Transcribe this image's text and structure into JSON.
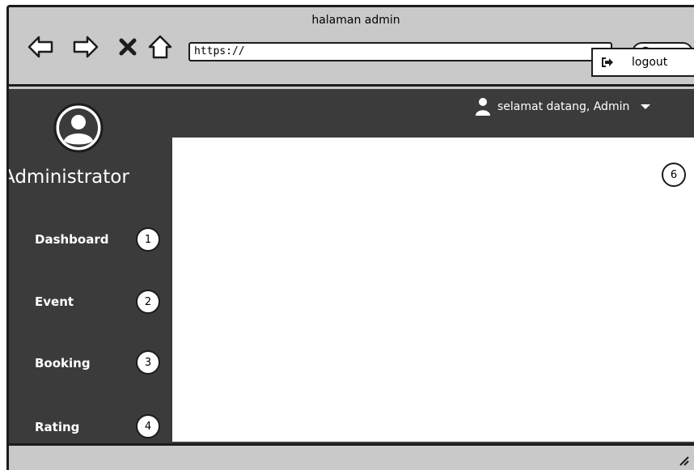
{
  "window": {
    "title": "halaman admin"
  },
  "browser": {
    "url": "https://",
    "back_icon": "arrow-left-icon",
    "forward_icon": "arrow-right-icon",
    "stop_icon": "close-icon",
    "home_icon": "home-icon",
    "search_icon": "search-icon"
  },
  "header": {
    "greeting": "selamat datang, Admin",
    "user_icon": "user-icon",
    "caret_icon": "caret-down-icon"
  },
  "sidebar": {
    "title": "Administrator",
    "items": [
      {
        "label": "Dashboard",
        "badge": "1"
      },
      {
        "label": "Event",
        "badge": "2"
      },
      {
        "label": "Booking",
        "badge": "3"
      },
      {
        "label": "Rating",
        "badge": "4"
      }
    ]
  },
  "dropdown": {
    "logout_label": "logout",
    "logout_icon": "sign-out-icon",
    "badge": "6"
  },
  "colors": {
    "dark": "#3b3b3b",
    "chrome": "#c9c9c9",
    "border": "#1c1c1c",
    "content": "#ffffff"
  }
}
